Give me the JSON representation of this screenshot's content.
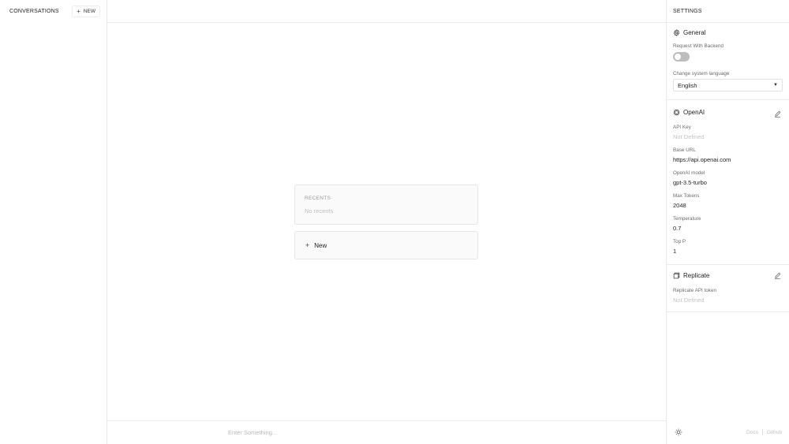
{
  "sidebar": {
    "title": "CONVERSATIONS",
    "new_label": "NEW"
  },
  "main": {
    "recents_title": "RECENTS",
    "recents_empty": "No recents",
    "new_label": "New",
    "input_placeholder": "Enter Something..."
  },
  "settings": {
    "title": "SETTINGS",
    "general": {
      "title": "General",
      "backend_label": "Request With Backend",
      "backend_enabled": false,
      "language_label": "Change system language",
      "language_value": "English"
    },
    "openai": {
      "title": "OpenAI",
      "api_key_label": "API Key",
      "api_key_value": "Not Defined",
      "base_url_label": "Base URL",
      "base_url_value": "https://api.openai.com",
      "model_label": "OpenAI model",
      "model_value": "gpt-3.5-turbo",
      "max_tokens_label": "Max Tokens",
      "max_tokens_value": "2048",
      "temperature_label": "Temperature",
      "temperature_value": "0.7",
      "top_p_label": "Top P",
      "top_p_value": "1"
    },
    "replicate": {
      "title": "Replicate",
      "token_label": "Replicate API token",
      "token_value": "Not Defined"
    },
    "footer": {
      "docs_label": "Docs",
      "github_label": "Github"
    }
  },
  "icons": {
    "plus": "+",
    "caret": "▼"
  }
}
